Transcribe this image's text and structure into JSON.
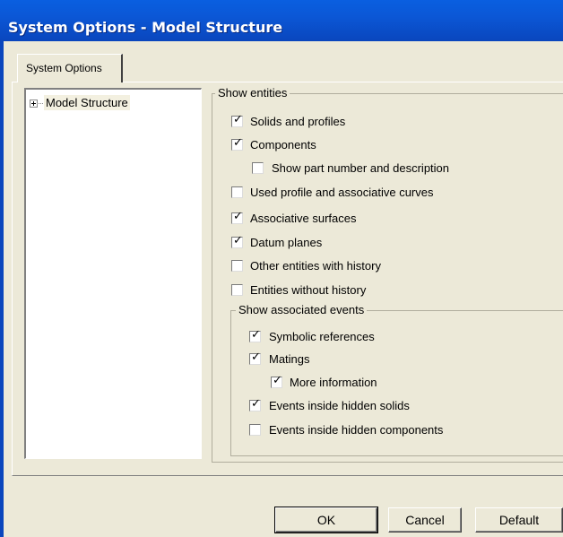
{
  "window": {
    "title": "System Options - Model Structure"
  },
  "tabs": [
    {
      "label": "System Options"
    }
  ],
  "tree": {
    "items": [
      {
        "label": "Model Structure",
        "expander": "plus-icon"
      }
    ]
  },
  "show_entities": {
    "title": "Show entities",
    "options": [
      {
        "label": "Solids and profiles",
        "checked": true
      },
      {
        "label": "Components",
        "checked": true
      },
      {
        "label": "Show part number and description",
        "checked": false
      },
      {
        "label": "Used profile and associative curves",
        "checked": false
      },
      {
        "label": "Associative surfaces",
        "checked": true
      },
      {
        "label": "Datum planes",
        "checked": true
      },
      {
        "label": "Other entities with history",
        "checked": false
      },
      {
        "label": "Entities without history",
        "checked": false
      }
    ]
  },
  "show_events": {
    "title": "Show associated events",
    "options": [
      {
        "label": "Symbolic references",
        "checked": true
      },
      {
        "label": "Matings",
        "checked": true
      },
      {
        "label": "More information",
        "checked": true
      },
      {
        "label": "Events inside hidden solids",
        "checked": true
      },
      {
        "label": "Events inside hidden components",
        "checked": false
      }
    ]
  },
  "buttons": {
    "ok": "OK",
    "cancel": "Cancel",
    "default": "Default"
  },
  "colors": {
    "titlebar": "#0a5fe0",
    "dialog_bg": "#ece9d8"
  }
}
